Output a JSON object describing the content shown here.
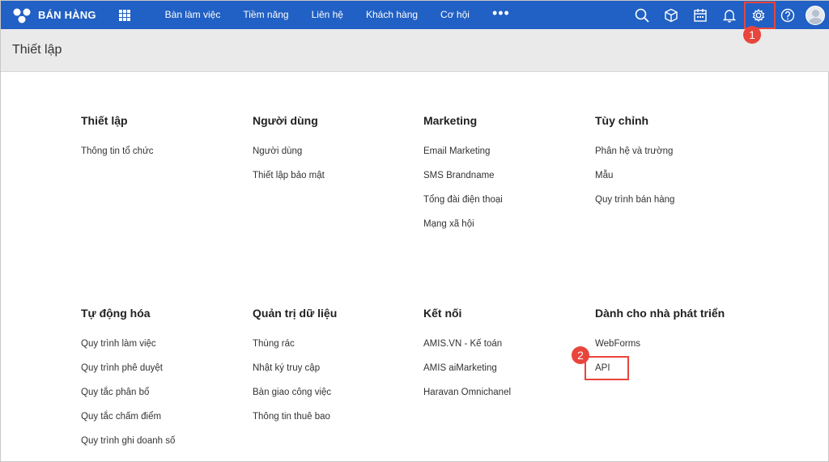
{
  "app": {
    "name": "BÁN HÀNG"
  },
  "nav": [
    "Bàn làm việc",
    "Tiềm năng",
    "Liên hệ",
    "Khách hàng",
    "Cơ hội"
  ],
  "nav_more": "•••",
  "topbar_icons": [
    "search-icon",
    "box-icon",
    "calendar-icon",
    "bell-icon",
    "gear-icon",
    "help-icon"
  ],
  "colors": {
    "topbar": "#2160c4",
    "highlight": "#e8453c",
    "subheader": "#eaeaea"
  },
  "page_title": "Thiết lập",
  "badges": {
    "one": "1",
    "two": "2"
  },
  "sections": [
    {
      "title": "Thiết lập",
      "links": [
        "Thông tin tổ chức"
      ]
    },
    {
      "title": "Người dùng",
      "links": [
        "Người dùng",
        "Thiết lập bảo mật"
      ]
    },
    {
      "title": "Marketing",
      "links": [
        "Email Marketing",
        "SMS Brandname",
        "Tổng đài điện thoại",
        "Mạng xã hội"
      ]
    },
    {
      "title": "Tùy chỉnh",
      "links": [
        "Phân hệ và trường",
        "Mẫu",
        "Quy trình bán hàng"
      ]
    },
    {
      "title": "Tự động hóa",
      "links": [
        "Quy trình làm việc",
        "Quy trình phê duyệt",
        "Quy tắc phân bổ",
        "Quy tắc chấm điểm",
        "Quy trình ghi doanh số"
      ]
    },
    {
      "title": "Quản trị dữ liệu",
      "links": [
        "Thùng rác",
        "Nhật ký truy cập",
        "Bàn giao công việc",
        "Thông tin thuê bao"
      ]
    },
    {
      "title": "Kết nối",
      "links": [
        "AMIS.VN - Kế toán",
        "AMIS aiMarketing",
        "Haravan Omnichanel"
      ]
    },
    {
      "title": "Dành cho nhà phát triển",
      "links": [
        "WebForms",
        "API"
      ]
    }
  ]
}
